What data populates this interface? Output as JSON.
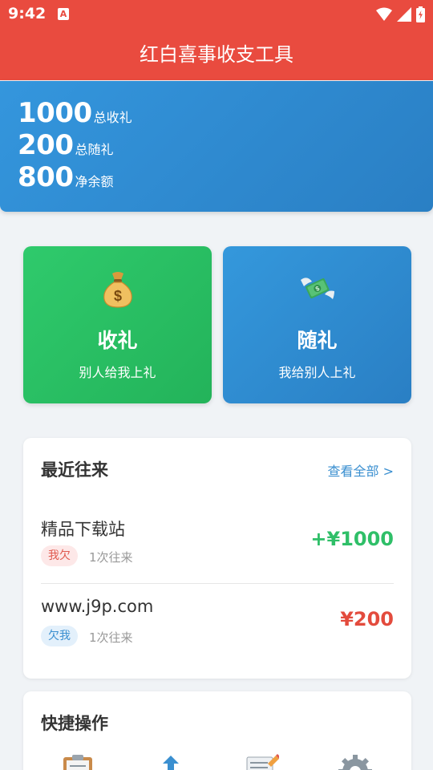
{
  "status_bar": {
    "time": "9:42",
    "app_badge": "A",
    "icons": [
      "wifi-icon",
      "signal-icon",
      "battery-icon"
    ]
  },
  "header": {
    "title": "红白喜事收支工具"
  },
  "summary": {
    "total_received_value": "1000",
    "total_received_label": "总收礼",
    "total_given_value": "200",
    "total_given_label": "总随礼",
    "net_value": "800",
    "net_label": "净余额"
  },
  "actions": {
    "receive": {
      "title": "收礼",
      "subtitle": "别人给我上礼",
      "icon": "money-bag-icon",
      "color": "#2bc265"
    },
    "give": {
      "title": "随礼",
      "subtitle": "我给别人上礼",
      "icon": "money-wings-icon",
      "color": "#3090d6"
    }
  },
  "recent": {
    "title": "最近往来",
    "view_all": "查看全部 >",
    "items": [
      {
        "name": "精品下载站",
        "tag": "我欠",
        "count": "1次往来",
        "amount": "+¥1000"
      },
      {
        "name": "www.j9p.com",
        "tag": "欠我",
        "count": "1次往来",
        "amount": "¥200"
      }
    ]
  },
  "quick_actions": {
    "title": "快捷操作",
    "icons": [
      "clipboard-icon",
      "upload-arrow-icon",
      "memo-icon",
      "gear-icon"
    ]
  },
  "colors": {
    "brand_red": "#e94b3f",
    "summary_blue": "#2f8ad0",
    "positive_green": "#2fbf68",
    "negative_red": "#e34b3d",
    "link_blue": "#3a8fd0"
  }
}
